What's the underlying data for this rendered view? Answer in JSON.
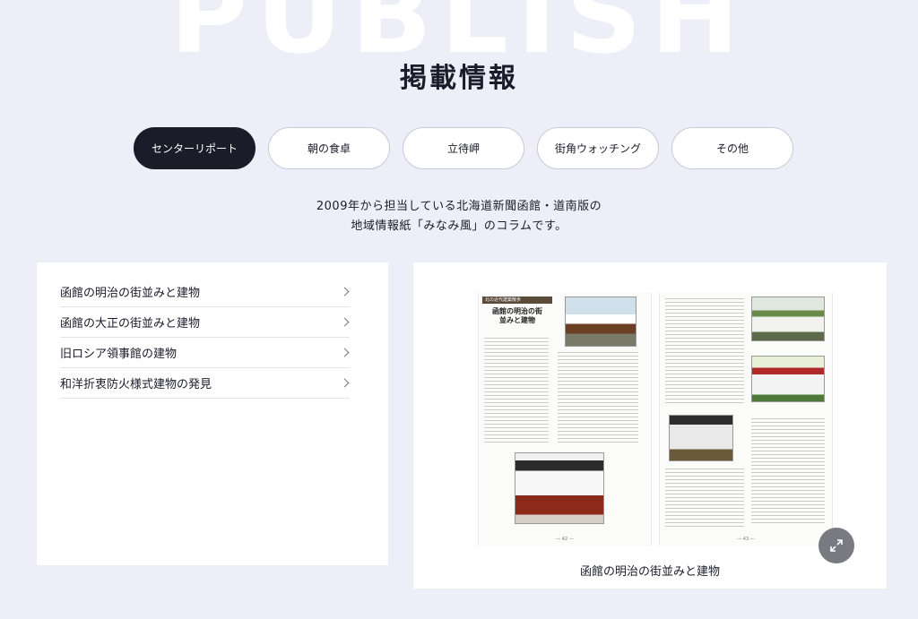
{
  "background_word": "PUBLISH",
  "section_title": "掲載情報",
  "tabs": [
    {
      "label": "センターリポート",
      "active": true
    },
    {
      "label": "朝の食卓",
      "active": false
    },
    {
      "label": "立待岬",
      "active": false
    },
    {
      "label": "街角ウォッチング",
      "active": false
    },
    {
      "label": "その他",
      "active": false
    }
  ],
  "intro": {
    "line1": "2009年から担当している北海道新聞函館・道南版の",
    "line2": "地域情報紙「みなみ風」のコラムです。"
  },
  "articles": [
    {
      "title": "函館の明治の街並みと建物"
    },
    {
      "title": "函館の大正の街並みと建物"
    },
    {
      "title": "旧ロシア領事館の建物"
    },
    {
      "title": "和洋折衷防火様式建物の発見"
    }
  ],
  "preview": {
    "caption": "函館の明治の街並みと建物",
    "page_header": "北の近代建築散歩",
    "page_title": "函館の明治の街並みと建物",
    "expand_icon": "expand-arrows-icon"
  },
  "colors": {
    "background": "#eeeef9",
    "active_tab": "#1b1b2a",
    "expand_button": "#797982"
  }
}
